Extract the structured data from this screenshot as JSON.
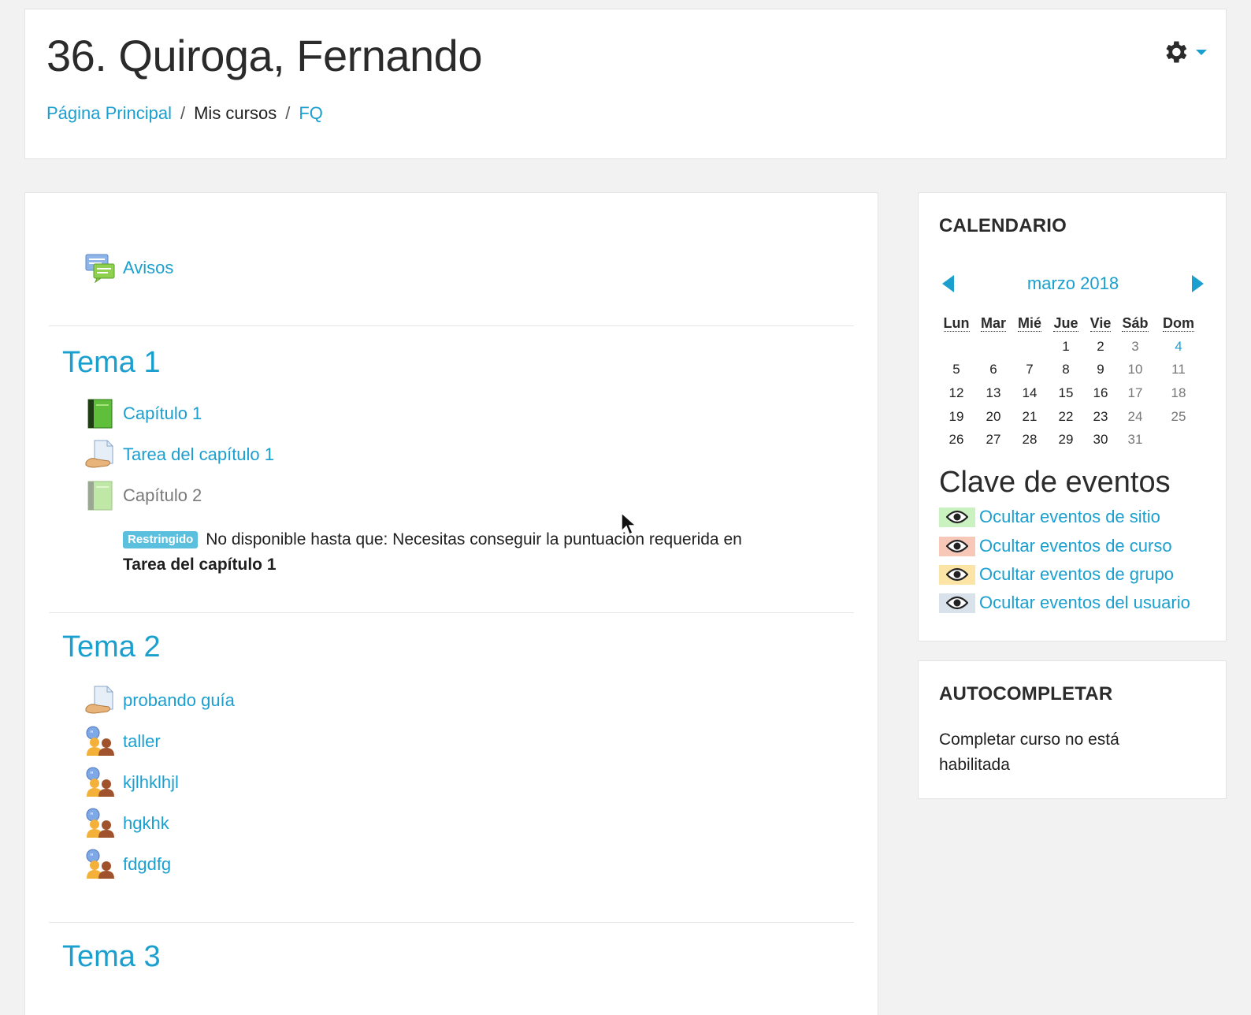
{
  "header": {
    "title": "36. Quiroga, Fernando",
    "breadcrumb": [
      {
        "label": "Página Principal"
      },
      {
        "label": "Mis cursos"
      },
      {
        "label": "FQ"
      }
    ],
    "separator": "/"
  },
  "course": {
    "announcements": {
      "label": "Avisos",
      "icon": "forum-icon"
    },
    "sections": [
      {
        "title": "Tema 1",
        "activities": [
          {
            "label": "Capítulo 1",
            "icon": "book-icon"
          },
          {
            "label": "Tarea del capítulo 1",
            "icon": "assignment-icon"
          },
          {
            "label": "Capítulo 2",
            "icon": "book-icon",
            "restricted": true
          }
        ],
        "restriction": {
          "badge": "Restringido",
          "text": "No disponible hasta que: Necesitas conseguir la puntuación requerida en",
          "target": "Tarea del capítulo 1"
        }
      },
      {
        "title": "Tema 2",
        "activities": [
          {
            "label": "probando guía",
            "icon": "assignment-icon"
          },
          {
            "label": "taller",
            "icon": "workshop-icon"
          },
          {
            "label": "kjlhklhjl",
            "icon": "workshop-icon"
          },
          {
            "label": "hgkhk",
            "icon": "workshop-icon"
          },
          {
            "label": "fdgdfg",
            "icon": "workshop-icon"
          }
        ]
      },
      {
        "title": "Tema 3",
        "activities": []
      }
    ]
  },
  "calendar": {
    "block_title": "CALENDARIO",
    "month": "marzo 2018",
    "weekdays": [
      "Lun",
      "Mar",
      "Mié",
      "Jue",
      "Vie",
      "Sáb",
      "Dom"
    ],
    "weeks": [
      [
        "",
        "",
        "",
        "1",
        "2",
        "3",
        "4"
      ],
      [
        "5",
        "6",
        "7",
        "8",
        "9",
        "10",
        "11"
      ],
      [
        "12",
        "13",
        "14",
        "15",
        "16",
        "17",
        "18"
      ],
      [
        "19",
        "20",
        "21",
        "22",
        "23",
        "24",
        "25"
      ],
      [
        "26",
        "27",
        "28",
        "29",
        "30",
        "31",
        ""
      ]
    ],
    "today": "4",
    "events_key_title": "Clave de eventos",
    "event_toggles": [
      {
        "label": "Ocultar eventos de sitio",
        "color": "#c9f2c0"
      },
      {
        "label": "Ocultar eventos de curso",
        "color": "#f7c7b8"
      },
      {
        "label": "Ocultar eventos de grupo",
        "color": "#fbe4a6"
      },
      {
        "label": "Ocultar eventos del usuario",
        "color": "#d9e2ea"
      }
    ]
  },
  "autocomplete": {
    "block_title": "AUTOCOMPLETAR",
    "text": "Completar curso no está habilitada"
  },
  "colors": {
    "accent": "#1a9fcf",
    "badge": "#5bc0de"
  }
}
